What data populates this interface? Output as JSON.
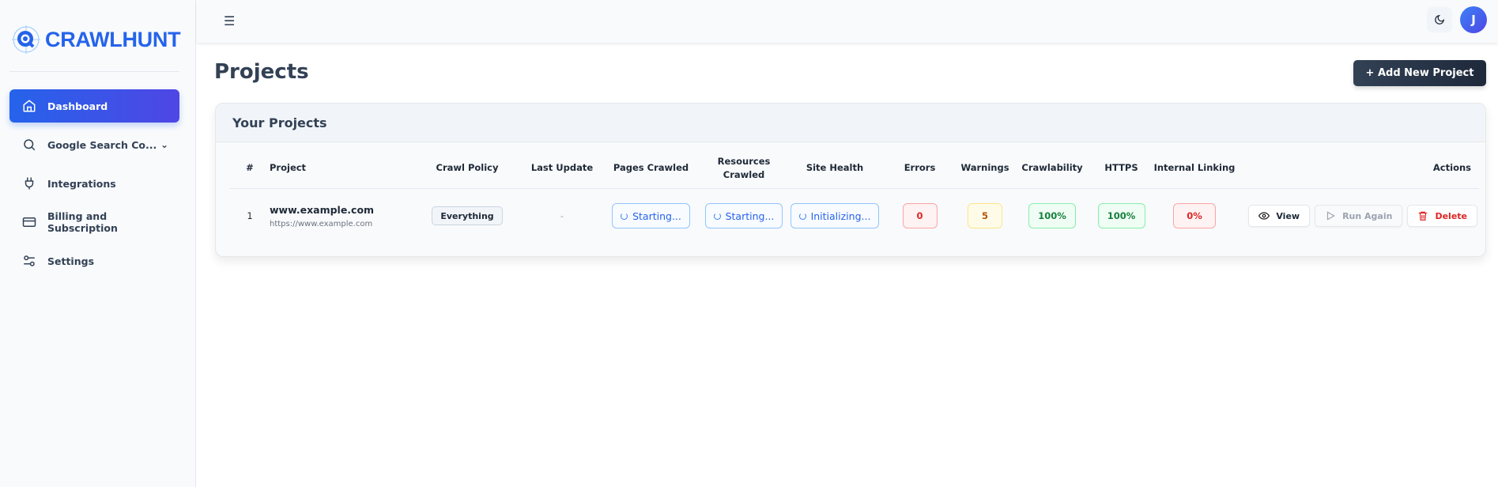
{
  "brand": {
    "name": "CRAWLHUNT",
    "color": "#2563eb"
  },
  "sidebar": {
    "items": [
      {
        "label": "Dashboard",
        "icon": "home-icon",
        "active": true
      },
      {
        "label": "Google Search Co...",
        "icon": "search-icon",
        "expandable": true
      },
      {
        "label": "Integrations",
        "icon": "plug-icon"
      },
      {
        "label": "Billing and Subscription",
        "icon": "credit-card-icon"
      },
      {
        "label": "Settings",
        "icon": "sliders-icon"
      }
    ]
  },
  "header": {
    "menu_icon": "☰",
    "theme_icon": "moon-icon",
    "avatar_initial": "J"
  },
  "page": {
    "title": "Projects",
    "add_button": "+ Add New Project"
  },
  "projects": {
    "title": "Your Projects",
    "columns": [
      "#",
      "Project",
      "Crawl Policy",
      "Last Update",
      "Pages Crawled",
      "Resources Crawled",
      "Site Health",
      "Errors",
      "Warnings",
      "Crawlability",
      "HTTPS",
      "Internal Linking",
      "Actions"
    ],
    "rows": [
      {
        "index": "1",
        "name": "www.example.com",
        "url": "https://www.example.com",
        "crawl_policy": "Everything",
        "last_update": "-",
        "pages_crawled": "Starting...",
        "resources_crawled": "Starting...",
        "site_health": "Initializing...",
        "errors": "0",
        "warnings": "5",
        "crawlability": "100%",
        "https": "100%",
        "internal_linking": "0%",
        "actions": {
          "view": "View",
          "run_again": "Run Again",
          "delete": "Delete"
        }
      }
    ]
  }
}
